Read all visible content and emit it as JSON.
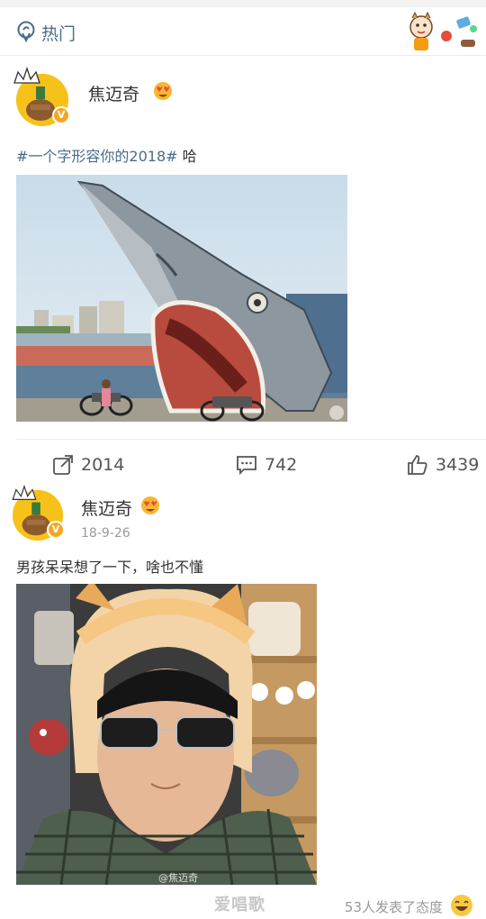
{
  "header": {
    "title": "热门",
    "location_icon": "location-pin-icon",
    "decoration_icon": "cartoon-stickers-icon"
  },
  "posts": [
    {
      "author": "焦迈奇",
      "timestamp": "",
      "hashtag": "#一个字形容你的2018#",
      "text": " 哈",
      "image_desc": "shark-sculpture-photo",
      "actions": {
        "repost_count": "2014",
        "comment_count": "742",
        "like_count": "3439"
      }
    },
    {
      "author": "焦迈奇",
      "timestamp": "18-9-26",
      "text": "男孩呆呆想了一下，啥也不懂",
      "image_desc": "selfie-cat-hat-photo",
      "photo_credit": "@焦迈奇"
    }
  ],
  "footer": {
    "watermark": "爱唱歌",
    "reactions_text": "53人发表了态度"
  },
  "colors": {
    "link": "#4a6c8a",
    "badge": "#f5a623",
    "avatar_bg": "#f6c21a"
  }
}
